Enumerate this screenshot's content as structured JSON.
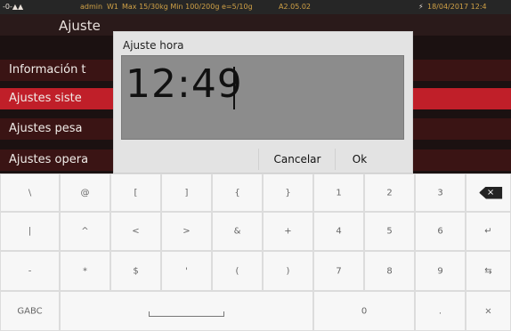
{
  "status_bar": {
    "icons": "-0-▲▲",
    "user": "admin",
    "scale": "W1",
    "capacity": "Max 15/30kg Min 100/200g e=5/10g",
    "version": "A2.05.02",
    "datetime": "18/04/2017 12:4",
    "battery_icon": "lightning-icon"
  },
  "background": {
    "title": "Ajuste",
    "menu": [
      {
        "label": "Información t",
        "selected": false
      },
      {
        "label": "Ajustes siste",
        "selected": true
      },
      {
        "label": "Ajustes pesa",
        "selected": false
      },
      {
        "label": "Ajustes opera",
        "selected": false
      }
    ]
  },
  "dialog": {
    "title": "Ajuste hora",
    "value": "12:49",
    "cancel_label": "Cancelar",
    "ok_label": "Ok"
  },
  "keyboard": {
    "rows": [
      [
        "\\",
        "@",
        "[",
        "]",
        "{",
        "}",
        "1",
        "2",
        "3",
        "backspace-icon"
      ],
      [
        "|",
        "^",
        "<",
        ">",
        "&",
        "+",
        "4",
        "5",
        "6",
        "enter-icon"
      ],
      [
        "-",
        "*",
        "$",
        "'",
        "(",
        ")",
        "7",
        "8",
        "9",
        "tab-icon"
      ],
      [
        "GABC",
        "space-icon",
        "0",
        ".",
        "×"
      ]
    ],
    "labels": {
      "r0": [
        "\\",
        "@",
        "[",
        "]",
        "{",
        "}",
        "1",
        "2",
        "3",
        ""
      ],
      "r1": [
        "|",
        "^",
        "<",
        ">",
        "&",
        "+",
        "4",
        "5",
        "6",
        "↵"
      ],
      "r2": [
        "-",
        "*",
        "$",
        "'",
        "(",
        ")",
        "7",
        "8",
        "9",
        "⇆"
      ],
      "r3_mode": "GABC",
      "r3_zero": "0",
      "r3_dot": ".",
      "r3_close": "×",
      "backspace_x": "×"
    }
  }
}
